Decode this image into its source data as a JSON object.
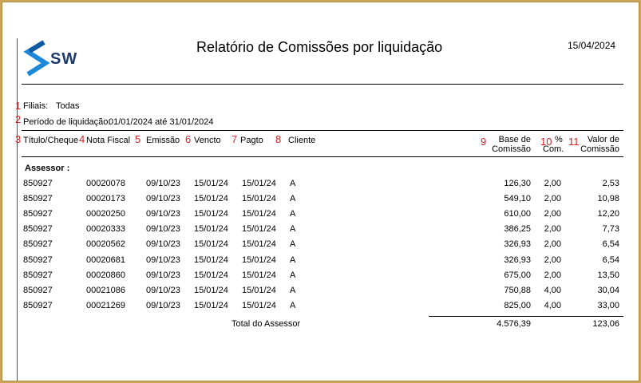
{
  "header": {
    "title": "Relatório de Comissões por liquidação",
    "date": "15/04/2024",
    "logo_text": "SW"
  },
  "filters": {
    "filiais_label": "Filiais:",
    "filiais_value": "Todas",
    "periodo_label": "Período de liquidação:",
    "periodo_value": "01/01/2024 até 31/01/2024"
  },
  "markers": [
    "1",
    "2",
    "3",
    "4",
    "5",
    "6",
    "7",
    "8",
    "9",
    "10",
    "11"
  ],
  "columns": {
    "titulo": "Título/Cheque",
    "nota": "Nota Fiscal",
    "emissao": "Emissão",
    "vencto": "Vencto",
    "pagto": "Pagto",
    "cliente": "Cliente",
    "base_line1": "Base de",
    "base_line2": "Comissão",
    "pct_line1": "%",
    "pct_line2": "Com.",
    "valor_line1": "Valor de",
    "valor_line2": "Comissão"
  },
  "section_label": "Assessor :",
  "rows": [
    {
      "titulo": "850927",
      "nota": "00020078",
      "emissao": "09/10/23",
      "vencto": "15/01/24",
      "pagto": "15/01/24",
      "cliente": "A",
      "base": "126,30",
      "pct": "2,00",
      "valor": "2,53"
    },
    {
      "titulo": "850927",
      "nota": "00020173",
      "emissao": "09/10/23",
      "vencto": "15/01/24",
      "pagto": "15/01/24",
      "cliente": "A",
      "base": "549,10",
      "pct": "2,00",
      "valor": "10,98"
    },
    {
      "titulo": "850927",
      "nota": "00020250",
      "emissao": "09/10/23",
      "vencto": "15/01/24",
      "pagto": "15/01/24",
      "cliente": "A",
      "base": "610,00",
      "pct": "2,00",
      "valor": "12,20"
    },
    {
      "titulo": "850927",
      "nota": "00020333",
      "emissao": "09/10/23",
      "vencto": "15/01/24",
      "pagto": "15/01/24",
      "cliente": "A",
      "base": "386,25",
      "pct": "2,00",
      "valor": "7,73"
    },
    {
      "titulo": "850927",
      "nota": "00020562",
      "emissao": "09/10/23",
      "vencto": "15/01/24",
      "pagto": "15/01/24",
      "cliente": "A",
      "base": "326,93",
      "pct": "2,00",
      "valor": "6,54"
    },
    {
      "titulo": "850927",
      "nota": "00020681",
      "emissao": "09/10/23",
      "vencto": "15/01/24",
      "pagto": "15/01/24",
      "cliente": "A",
      "base": "326,93",
      "pct": "2,00",
      "valor": "6,54"
    },
    {
      "titulo": "850927",
      "nota": "00020860",
      "emissao": "09/10/23",
      "vencto": "15/01/24",
      "pagto": "15/01/24",
      "cliente": "A",
      "base": "675,00",
      "pct": "2,00",
      "valor": "13,50"
    },
    {
      "titulo": "850927",
      "nota": "00021086",
      "emissao": "09/10/23",
      "vencto": "15/01/24",
      "pagto": "15/01/24",
      "cliente": "A",
      "base": "750,88",
      "pct": "4,00",
      "valor": "30,04"
    },
    {
      "titulo": "850927",
      "nota": "00021269",
      "emissao": "09/10/23",
      "vencto": "15/01/24",
      "pagto": "15/01/24",
      "cliente": "A",
      "base": "825,00",
      "pct": "4,00",
      "valor": "33,00"
    }
  ],
  "total": {
    "label": "Total do Assessor",
    "base": "4.576,39",
    "valor": "123,06"
  },
  "colors": {
    "logo_blue": "#1e88d8",
    "logo_dark": "#1e3a6a",
    "marker_red": "#d42020",
    "frame_border": "#c9a65a"
  }
}
